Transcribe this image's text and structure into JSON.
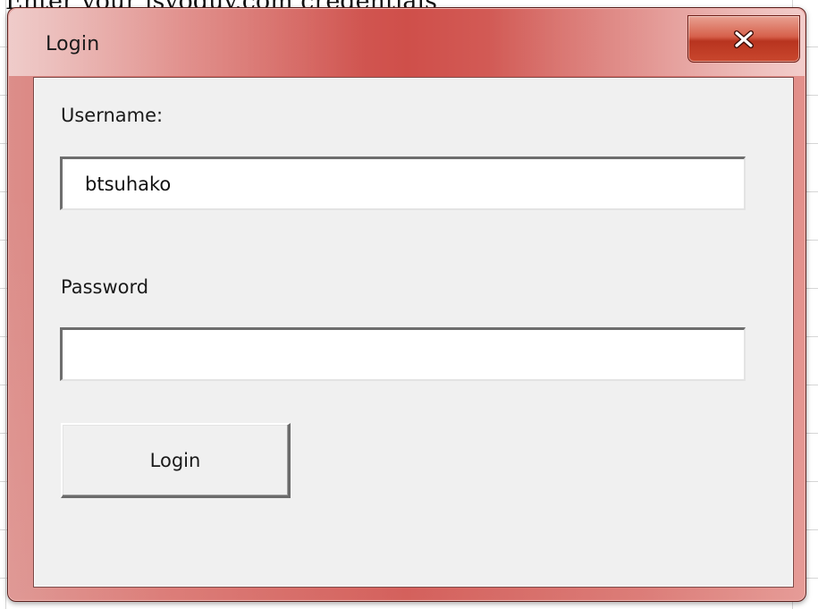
{
  "background": {
    "cell_text": "Enter your isyoguy.com credentials"
  },
  "window": {
    "title": "Login",
    "accent_color": "#d05a55",
    "close_button": {
      "icon": "close-icon",
      "label": "X"
    }
  },
  "form": {
    "username_label": "Username:",
    "username_value": "btsuhako",
    "password_label": "Password",
    "password_value": "",
    "submit_label": "Login"
  }
}
